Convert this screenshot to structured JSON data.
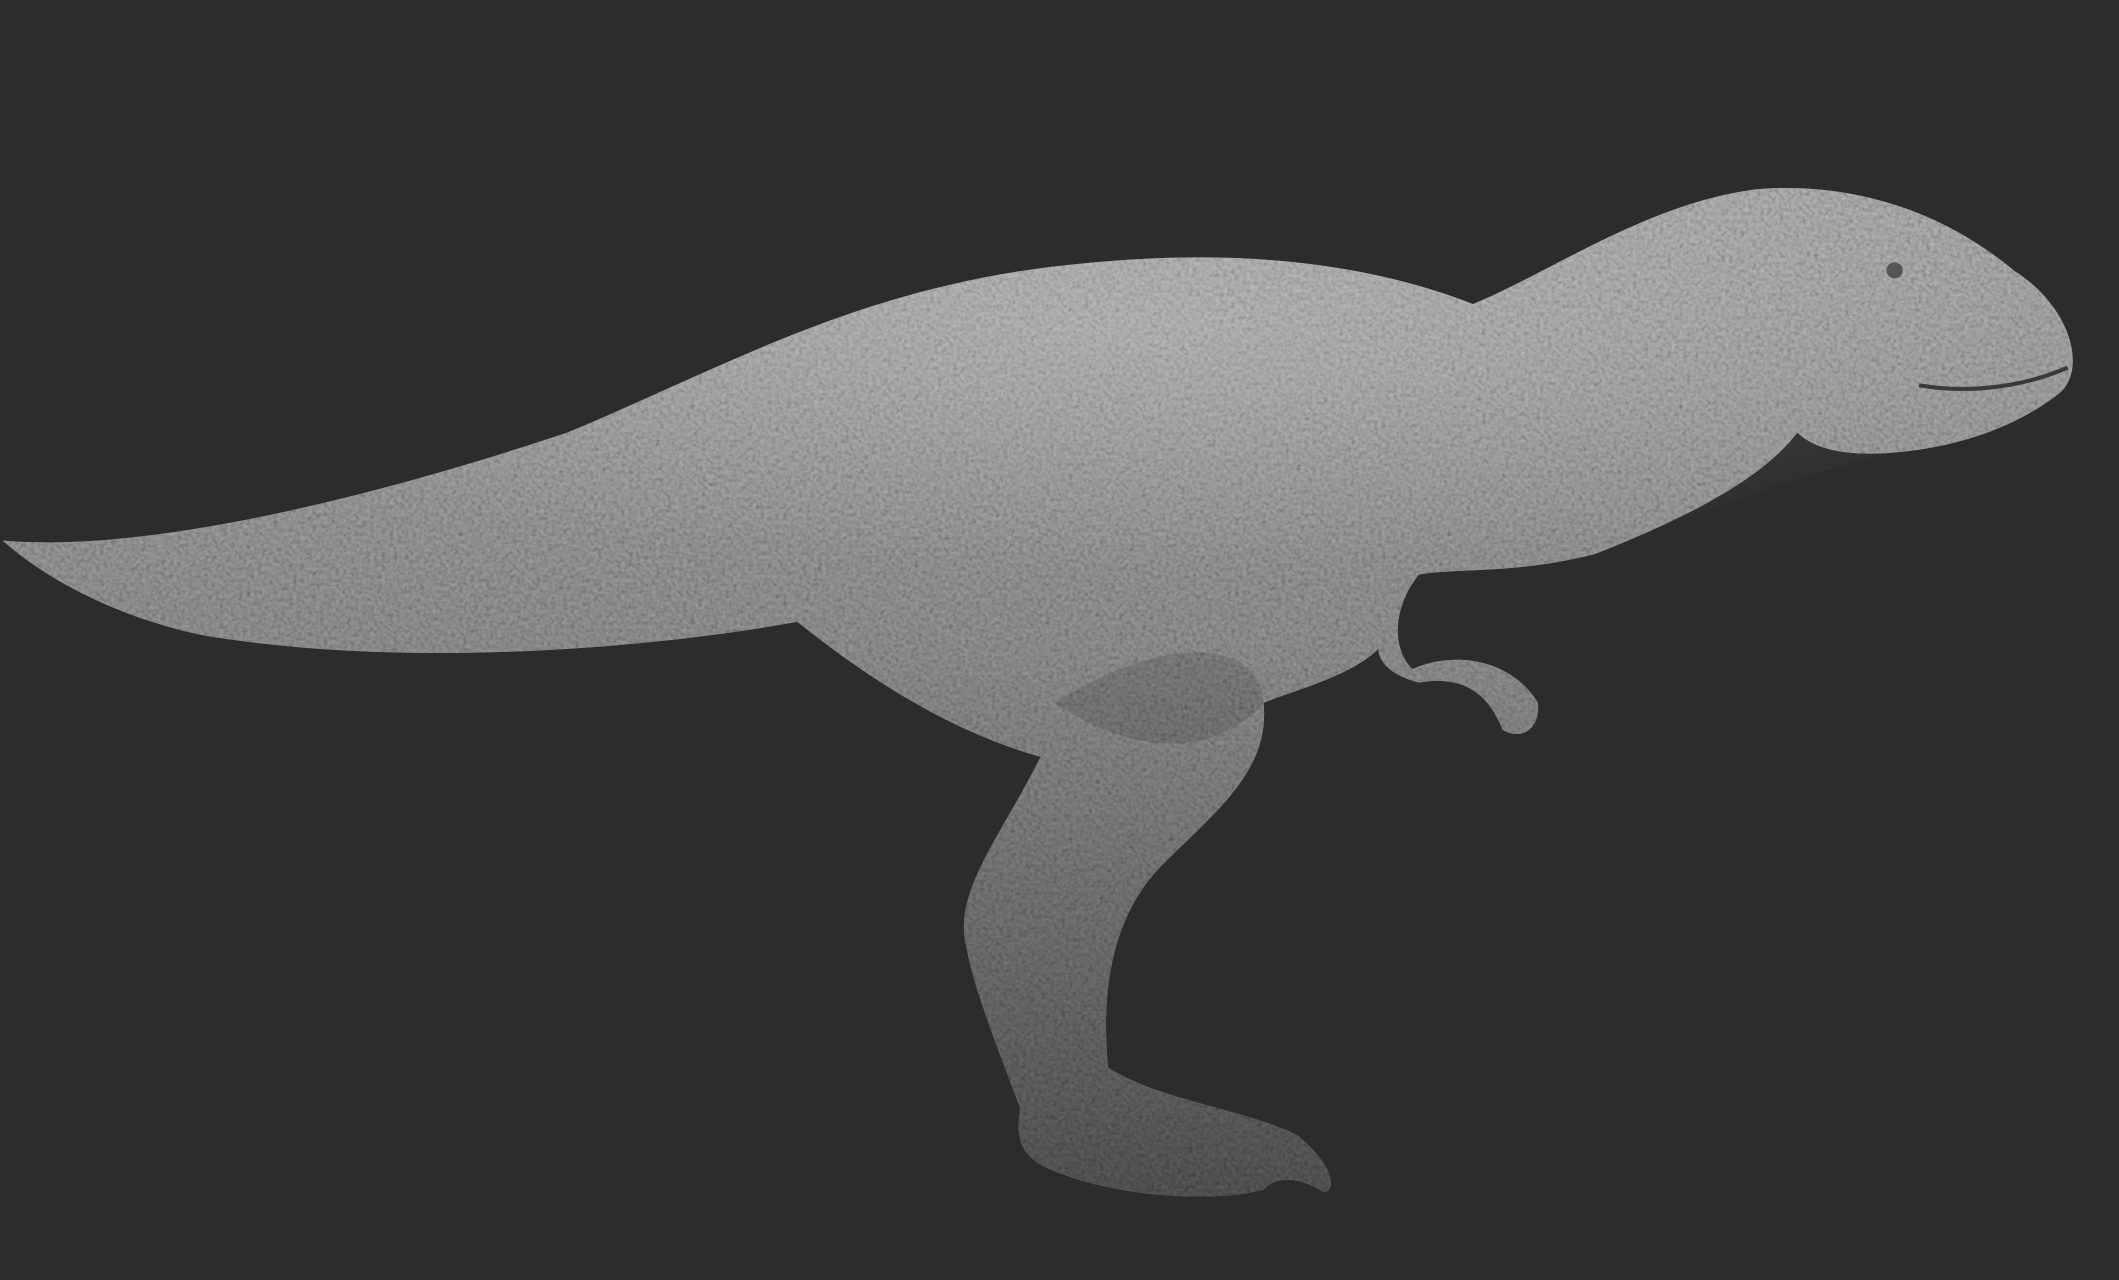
{
  "scene": {
    "subject": "t-rex-sculpt",
    "colors": {
      "background": "#2c2c2c",
      "model_light": "#b4b4b4",
      "model_mid": "#8a8a8a",
      "model_dark": "#4a4a4a"
    }
  }
}
